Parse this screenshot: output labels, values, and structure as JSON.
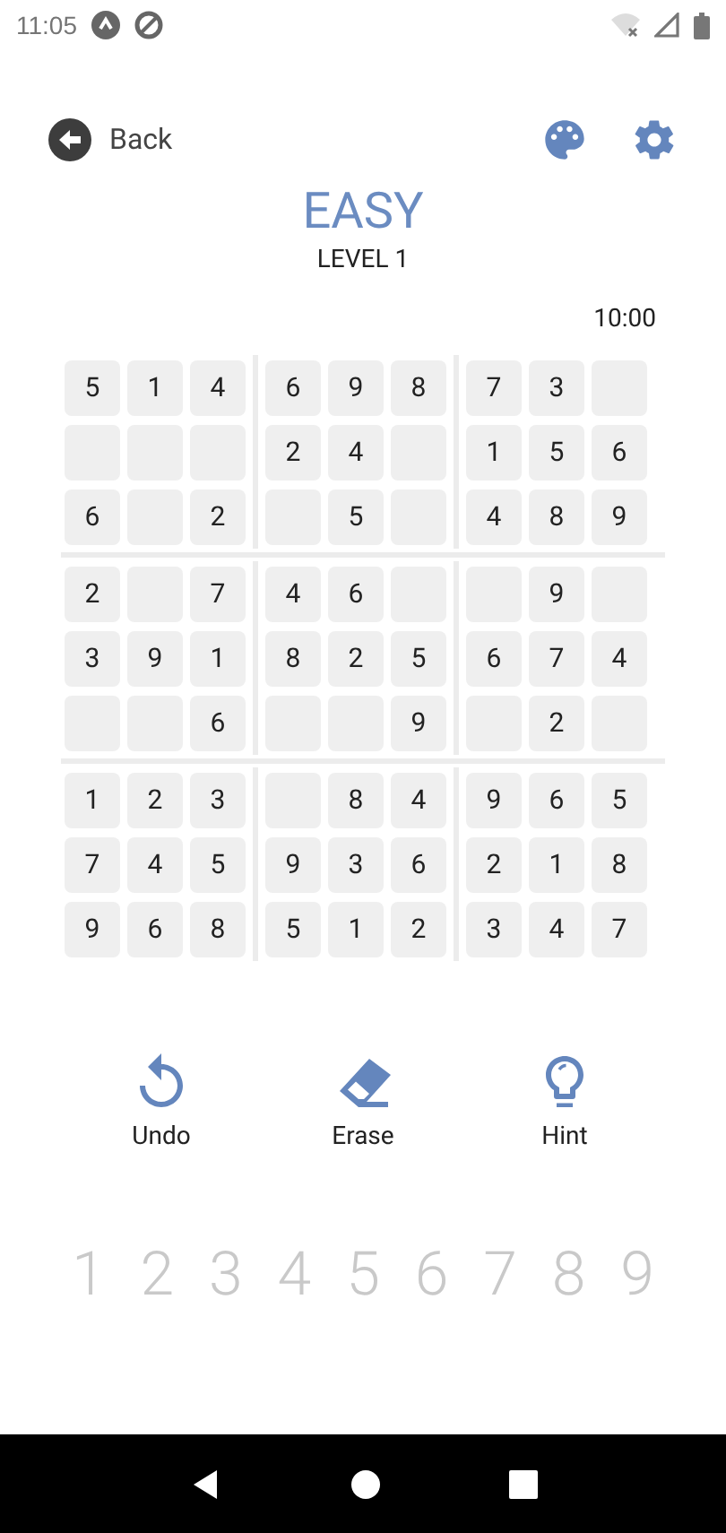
{
  "status_bar": {
    "time": "11:05"
  },
  "header": {
    "back_label": "Back"
  },
  "title": "EASY",
  "subtitle": "LEVEL 1",
  "timer": "10:00",
  "board": [
    [
      {
        "kind": "digit",
        "value": "5"
      },
      {
        "kind": "digit",
        "value": "1"
      },
      {
        "kind": "digit",
        "value": "4"
      },
      {
        "kind": "digit",
        "value": "6"
      },
      {
        "kind": "digit",
        "value": "9"
      },
      {
        "kind": "digit",
        "value": "8"
      },
      {
        "kind": "digit",
        "value": "7"
      },
      {
        "kind": "digit",
        "value": "3"
      },
      {
        "kind": "empty"
      }
    ],
    [
      {
        "kind": "empty"
      },
      {
        "kind": "empty"
      },
      {
        "kind": "empty"
      },
      {
        "kind": "digit",
        "value": "2"
      },
      {
        "kind": "digit",
        "value": "4"
      },
      {
        "kind": "empty"
      },
      {
        "kind": "digit",
        "value": "1"
      },
      {
        "kind": "digit",
        "value": "5"
      },
      {
        "kind": "digit",
        "value": "6"
      }
    ],
    [
      {
        "kind": "digit",
        "value": "6"
      },
      {
        "kind": "empty"
      },
      {
        "kind": "digit",
        "value": "2"
      },
      {
        "kind": "empty"
      },
      {
        "kind": "digit",
        "value": "5"
      },
      {
        "kind": "empty"
      },
      {
        "kind": "digit",
        "value": "4"
      },
      {
        "kind": "digit",
        "value": "8"
      },
      {
        "kind": "digit",
        "value": "9"
      }
    ],
    [
      {
        "kind": "digit",
        "value": "2"
      },
      {
        "kind": "empty"
      },
      {
        "kind": "digit",
        "value": "7"
      },
      {
        "kind": "digit",
        "value": "4"
      },
      {
        "kind": "digit",
        "value": "6"
      },
      {
        "kind": "empty"
      },
      {
        "kind": "empty"
      },
      {
        "kind": "digit",
        "value": "9"
      },
      {
        "kind": "empty"
      }
    ],
    [
      {
        "kind": "digit",
        "value": "3"
      },
      {
        "kind": "digit",
        "value": "9"
      },
      {
        "kind": "digit",
        "value": "1"
      },
      {
        "kind": "digit",
        "value": "8"
      },
      {
        "kind": "digit",
        "value": "2"
      },
      {
        "kind": "digit",
        "value": "5"
      },
      {
        "kind": "digit",
        "value": "6"
      },
      {
        "kind": "digit",
        "value": "7"
      },
      {
        "kind": "digit",
        "value": "4"
      }
    ],
    [
      {
        "kind": "empty"
      },
      {
        "kind": "empty"
      },
      {
        "kind": "digit",
        "value": "6"
      },
      {
        "kind": "empty"
      },
      {
        "kind": "empty"
      },
      {
        "kind": "digit",
        "value": "9"
      },
      {
        "kind": "empty"
      },
      {
        "kind": "digit",
        "value": "2"
      },
      {
        "kind": "empty"
      }
    ],
    [
      {
        "kind": "digit",
        "value": "1"
      },
      {
        "kind": "digit",
        "value": "2"
      },
      {
        "kind": "digit",
        "value": "3"
      },
      {
        "kind": "empty"
      },
      {
        "kind": "digit",
        "value": "8"
      },
      {
        "kind": "digit",
        "value": "4"
      },
      {
        "kind": "digit",
        "value": "9"
      },
      {
        "kind": "digit",
        "value": "6"
      },
      {
        "kind": "digit",
        "value": "5"
      }
    ],
    [
      {
        "kind": "digit",
        "value": "7"
      },
      {
        "kind": "digit",
        "value": "4"
      },
      {
        "kind": "digit",
        "value": "5"
      },
      {
        "kind": "digit",
        "value": "9"
      },
      {
        "kind": "digit",
        "value": "3"
      },
      {
        "kind": "digit",
        "value": "6"
      },
      {
        "kind": "digit",
        "value": "2"
      },
      {
        "kind": "digit",
        "value": "1"
      },
      {
        "kind": "digit",
        "value": "8"
      }
    ],
    [
      {
        "kind": "digit",
        "value": "9"
      },
      {
        "kind": "digit",
        "value": "6"
      },
      {
        "kind": "digit",
        "value": "8"
      },
      {
        "kind": "digit",
        "value": "5"
      },
      {
        "kind": "digit",
        "value": "1"
      },
      {
        "kind": "digit",
        "value": "2"
      },
      {
        "kind": "digit",
        "value": "3"
      },
      {
        "kind": "digit",
        "value": "4"
      },
      {
        "kind": "digit",
        "value": "7"
      }
    ]
  ],
  "actions": [
    {
      "kind": "undo",
      "label": "Undo"
    },
    {
      "kind": "erase",
      "label": "Erase"
    },
    {
      "kind": "hint",
      "label": "Hint"
    }
  ],
  "number_pad": [
    "1",
    "2",
    "3",
    "4",
    "5",
    "6",
    "7",
    "8",
    "9"
  ]
}
